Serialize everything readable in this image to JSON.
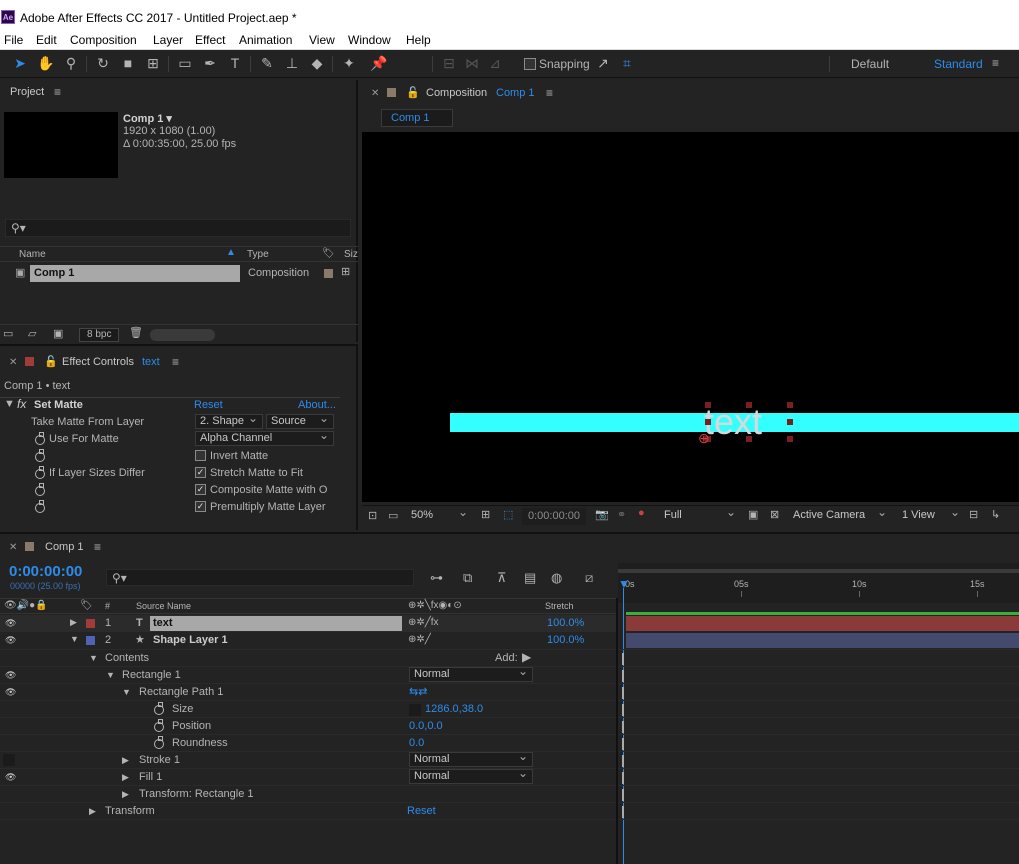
{
  "window": {
    "title": "Adobe After Effects CC 2017 - Untitled Project.aep *",
    "logo": "Ae"
  },
  "menu": [
    "File",
    "Edit",
    "Composition",
    "Layer",
    "Effect",
    "Animation",
    "View",
    "Window",
    "Help"
  ],
  "toolbar": {
    "snapping": "Snapping",
    "workspace_default": "Default",
    "workspace_standard": "Standard"
  },
  "project": {
    "title": "Project",
    "comp_name": "Comp 1 ▾",
    "comp_res": "1920 x 1080 (1.00)",
    "comp_dur": "Δ 0:00:35:00, 25.00 fps",
    "search_placeholder": "",
    "col_name": "Name",
    "col_type": "Type",
    "col_size": "Siz",
    "item_name": "Comp 1",
    "item_type": "Composition",
    "bpc": "8 bpc"
  },
  "effect_controls": {
    "title": "Effect Controls",
    "layer": "text",
    "breadcrumb": "Comp 1 • text",
    "effect_name": "Set Matte",
    "reset": "Reset",
    "about": "About...",
    "props": {
      "take_matte": "Take Matte From Layer",
      "take_matte_val": "2. Shape",
      "take_matte_src": "Source",
      "use_for_matte": "Use For Matte",
      "use_for_matte_val": "Alpha Channel",
      "invert": "Invert Matte",
      "if_sizes": "If Layer Sizes Differ",
      "stretch": "Stretch Matte to Fit",
      "composite": "Composite Matte with O",
      "premultiply": "Premultiply Matte Layer"
    }
  },
  "composition": {
    "title": "Composition",
    "comp": "Comp 1",
    "tab": "Comp 1",
    "text_overlay": "text",
    "zoom": "50%",
    "timecode": "0:00:00:00",
    "quality": "Full",
    "camera": "Active Camera",
    "views": "1 View",
    "colors": {
      "matte_bar": "#33ffff"
    }
  },
  "timeline": {
    "title": "Comp 1",
    "timecode": "0:00:00:00",
    "frames": "00000 (25.00 fps)",
    "search_placeholder": "",
    "headers": {
      "num": "#",
      "source": "Source Name",
      "stretch": "Stretch"
    },
    "ruler": [
      "0s",
      "05s",
      "10s",
      "15s"
    ],
    "layers": [
      {
        "num": "1",
        "name": "text",
        "type": "T",
        "stretch": "100.0%",
        "color": "#a33b3b"
      },
      {
        "num": "2",
        "name": "Shape Layer 1",
        "type": "★",
        "stretch": "100.0%",
        "color": "#4f62b4"
      }
    ],
    "tree": {
      "contents": "Contents",
      "add": "Add:",
      "rect1": "Rectangle 1",
      "rect1_mode": "Normal",
      "rect_path": "Rectangle Path 1",
      "size": "Size",
      "size_val": "1286.0,38.0",
      "position": "Position",
      "position_val": "0.0,0.0",
      "roundness": "Roundness",
      "roundness_val": "0.0",
      "stroke": "Stroke 1",
      "stroke_mode": "Normal",
      "fill": "Fill 1",
      "fill_mode": "Normal",
      "transform_rect": "Transform: Rectangle 1",
      "transform": "Transform",
      "reset": "Reset"
    }
  }
}
